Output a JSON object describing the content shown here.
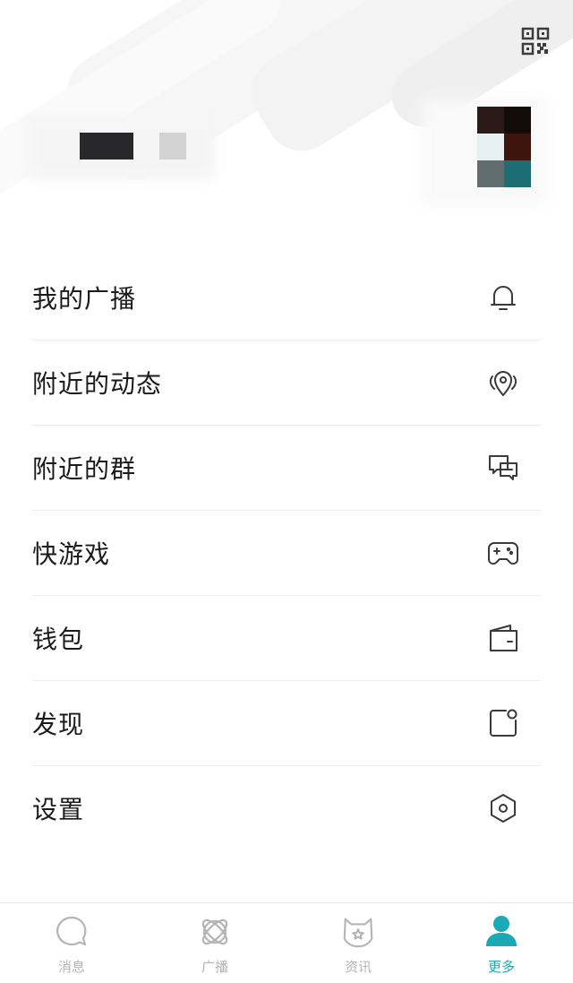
{
  "header": {
    "qr_icon": "qr-code-icon",
    "avatar_pixels": [
      "#2c1a18",
      "#130c09",
      "#e7f0f0",
      "#3e150d",
      "#5f6d6e",
      "#1d6d74"
    ]
  },
  "menu": {
    "items": [
      {
        "label": "我的广播",
        "icon": "bell-icon"
      },
      {
        "label": "附近的动态",
        "icon": "location-pin-icon"
      },
      {
        "label": "附近的群",
        "icon": "chat-bubbles-icon"
      },
      {
        "label": "快游戏",
        "icon": "gamepad-icon"
      },
      {
        "label": "钱包",
        "icon": "wallet-icon"
      },
      {
        "label": "发现",
        "icon": "discover-icon"
      },
      {
        "label": "设置",
        "icon": "settings-hexagon-icon"
      }
    ]
  },
  "tabbar": {
    "active_color": "#1aaab5",
    "inactive_color": "#b5b5b5",
    "tabs": [
      {
        "label": "消息",
        "icon": "message-bubble-icon",
        "active": false
      },
      {
        "label": "广播",
        "icon": "orbit-icon",
        "active": false
      },
      {
        "label": "资讯",
        "icon": "news-star-icon",
        "active": false
      },
      {
        "label": "更多",
        "icon": "profile-icon",
        "active": true
      }
    ]
  }
}
